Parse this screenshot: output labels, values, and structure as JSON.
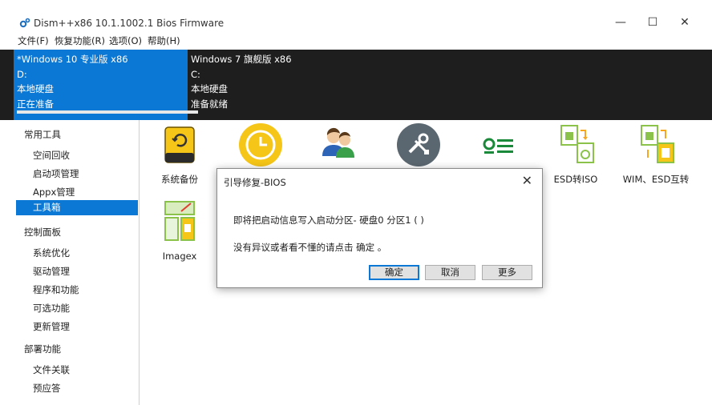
{
  "window": {
    "title": "Dism++x86 10.1.1002.1 Bios Firmware",
    "minimize": "—",
    "maximize": "☐",
    "close": "✕"
  },
  "menu": [
    "文件(F)",
    "恢复功能(R)",
    "选项(O)",
    "帮助(H)"
  ],
  "systems": [
    {
      "name": "*Windows 10 专业版 x86",
      "drive": "D:",
      "disk": "本地硬盘",
      "status": "正在准备"
    },
    {
      "name": "Windows 7 旗舰版 x86",
      "drive": "C:",
      "disk": "本地硬盘",
      "status": "准备就绪"
    }
  ],
  "sidebar": {
    "groups": [
      {
        "label": "常用工具",
        "items": [
          "空间回收",
          "启动项管理",
          "Appx管理",
          "工具箱"
        ]
      },
      {
        "label": "控制面板",
        "items": [
          "系统优化",
          "驱动管理",
          "程序和功能",
          "可选功能",
          "更新管理"
        ]
      },
      {
        "label": "部署功能",
        "items": [
          "文件关联",
          "预应答"
        ]
      }
    ],
    "selected": "工具箱"
  },
  "tools": [
    {
      "label": "系统备份",
      "icon": "drive-backup-icon"
    },
    {
      "label": "",
      "icon": "clock-restore-icon"
    },
    {
      "label": "",
      "icon": "users-icon"
    },
    {
      "label": "",
      "icon": "tools-icon"
    },
    {
      "label": "",
      "icon": "list-icon"
    },
    {
      "label": "ESD转ISO",
      "icon": "esd-iso-icon"
    },
    {
      "label": "WIM、ESD互转",
      "icon": "wim-esd-icon"
    },
    {
      "label": "Imagex",
      "icon": "imagex-icon"
    }
  ],
  "dialog": {
    "title": "引导修复-BIOS",
    "close": "✕",
    "message1": "即将把启动信息写入启动分区- 硬盘0 分区1 ( )",
    "message2": "没有异议或者看不懂的请点击 确定 。",
    "ok": "确定",
    "cancel": "取消",
    "more": "更多"
  },
  "colors": {
    "accent": "#0a78d4",
    "sysbar": "#1e1e1e"
  }
}
